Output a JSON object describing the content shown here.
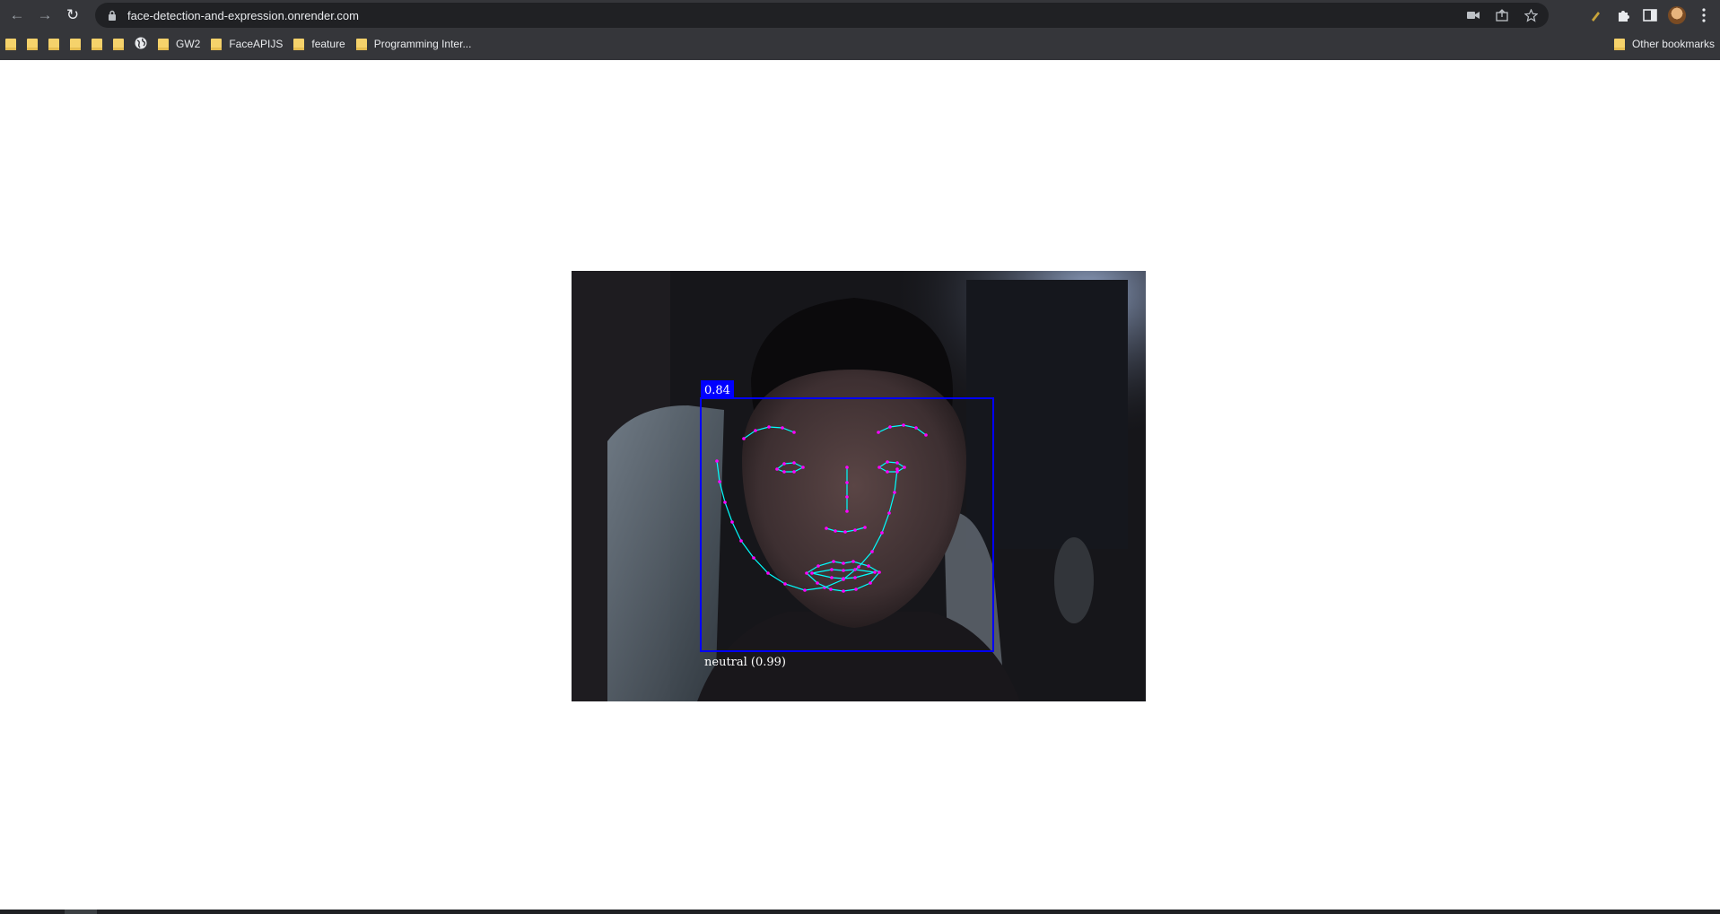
{
  "browser": {
    "url": "face-detection-and-expression.onrender.com",
    "bookmarks": [
      {
        "label": "",
        "icon": "folder-icon"
      },
      {
        "label": "",
        "icon": "folder-icon"
      },
      {
        "label": "",
        "icon": "folder-icon"
      },
      {
        "label": "",
        "icon": "folder-icon"
      },
      {
        "label": "",
        "icon": "folder-icon"
      },
      {
        "label": "",
        "icon": "folder-icon"
      },
      {
        "label": "",
        "icon": "globe-icon"
      },
      {
        "label": "GW2",
        "icon": "folder-icon"
      },
      {
        "label": "FaceAPIJS",
        "icon": "folder-icon"
      },
      {
        "label": "feature",
        "icon": "folder-icon"
      },
      {
        "label": "Programming Inter...",
        "icon": "folder-icon"
      }
    ],
    "other_bookmarks": "Other bookmarks"
  },
  "detection": {
    "score": "0.84",
    "expression": "neutral (0.99)",
    "box_color": "#0000ff",
    "landmark_line_color": "#00ffff",
    "landmark_point_color": "#ff00ff"
  }
}
